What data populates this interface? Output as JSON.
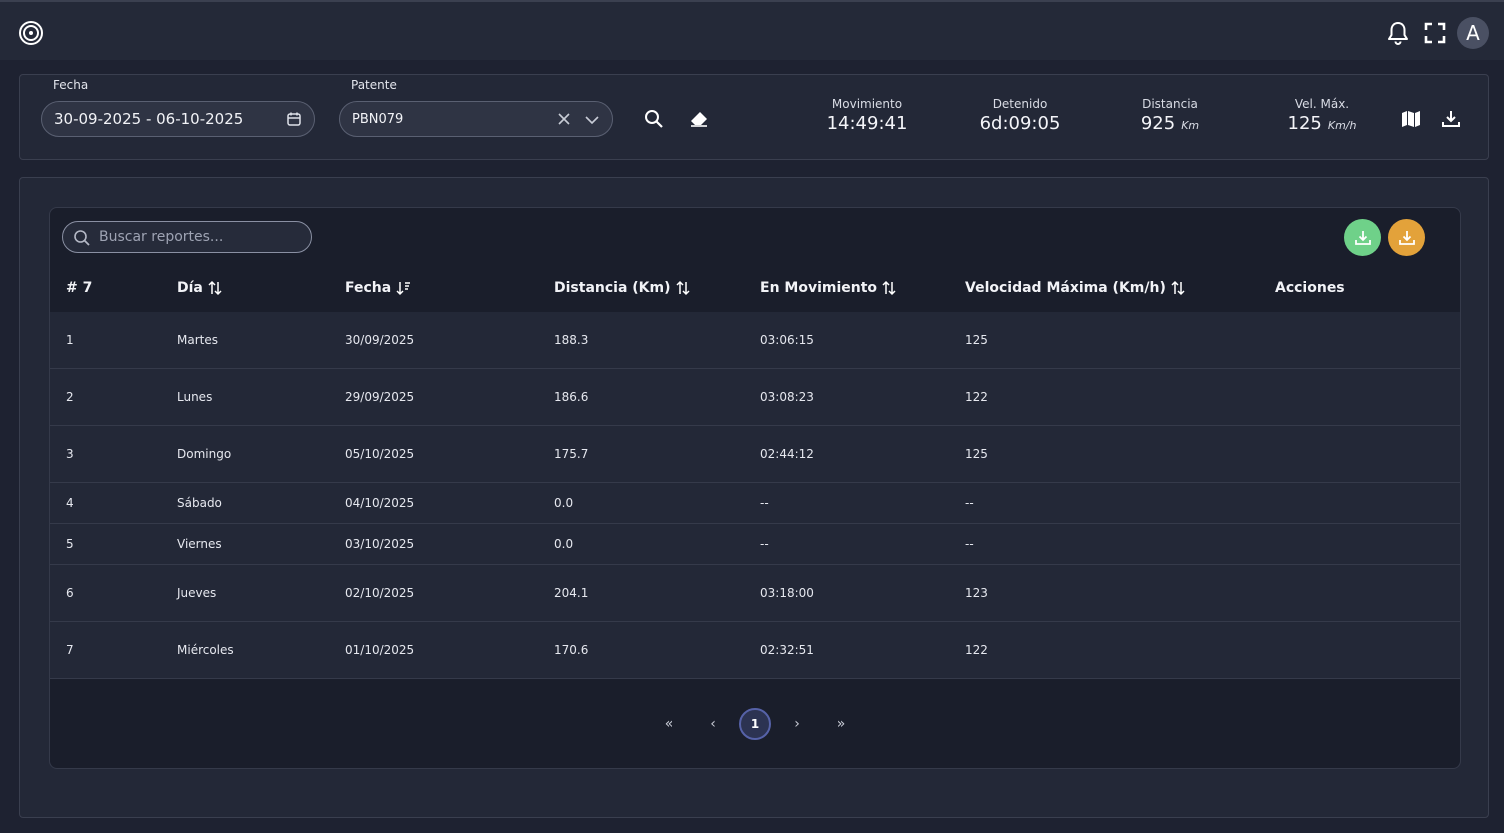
{
  "header": {
    "logo_icon": "target-logo",
    "avatar_letter": "A"
  },
  "filters": {
    "date_label": "Fecha",
    "date_value": "30-09-2025 - 06-10-2025",
    "plate_label": "Patente",
    "plate_value": "PBN079"
  },
  "stats": {
    "movement": {
      "label": "Movimiento",
      "value": "14:49:41"
    },
    "stopped": {
      "label": "Detenido",
      "value": "6d:09:05"
    },
    "distance": {
      "label": "Distancia",
      "value": "925",
      "unit": "Km"
    },
    "max_speed": {
      "label": "Vel. Máx.",
      "value": "125",
      "unit": "Km/h"
    }
  },
  "table": {
    "search_placeholder": "Buscar reportes...",
    "download_green_color": "#6fd189",
    "download_orange_color": "#e3a23a",
    "columns": {
      "index": "# 7",
      "day": "Día",
      "date": "Fecha",
      "distance": "Distancia (Km)",
      "moving": "En Movimiento",
      "max_speed": "Velocidad Máxima (Km/h)",
      "actions": "Acciones"
    },
    "rows": [
      {
        "n": "1",
        "day": "Martes",
        "date": "30/09/2025",
        "distance": "188.3",
        "moving": "03:06:15",
        "max_speed": "125"
      },
      {
        "n": "2",
        "day": "Lunes",
        "date": "29/09/2025",
        "distance": "186.6",
        "moving": "03:08:23",
        "max_speed": "122"
      },
      {
        "n": "3",
        "day": "Domingo",
        "date": "05/10/2025",
        "distance": "175.7",
        "moving": "02:44:12",
        "max_speed": "125"
      },
      {
        "n": "4",
        "day": "Sábado",
        "date": "04/10/2025",
        "distance": "0.0",
        "moving": "--",
        "max_speed": "--"
      },
      {
        "n": "5",
        "day": "Viernes",
        "date": "03/10/2025",
        "distance": "0.0",
        "moving": "--",
        "max_speed": "--"
      },
      {
        "n": "6",
        "day": "Jueves",
        "date": "02/10/2025",
        "distance": "204.1",
        "moving": "03:18:00",
        "max_speed": "123"
      },
      {
        "n": "7",
        "day": "Miércoles",
        "date": "01/10/2025",
        "distance": "170.6",
        "moving": "02:32:51",
        "max_speed": "122"
      }
    ]
  },
  "pagination": {
    "first": "«",
    "prev": "‹",
    "current": "1",
    "next": "›",
    "last": "»"
  }
}
